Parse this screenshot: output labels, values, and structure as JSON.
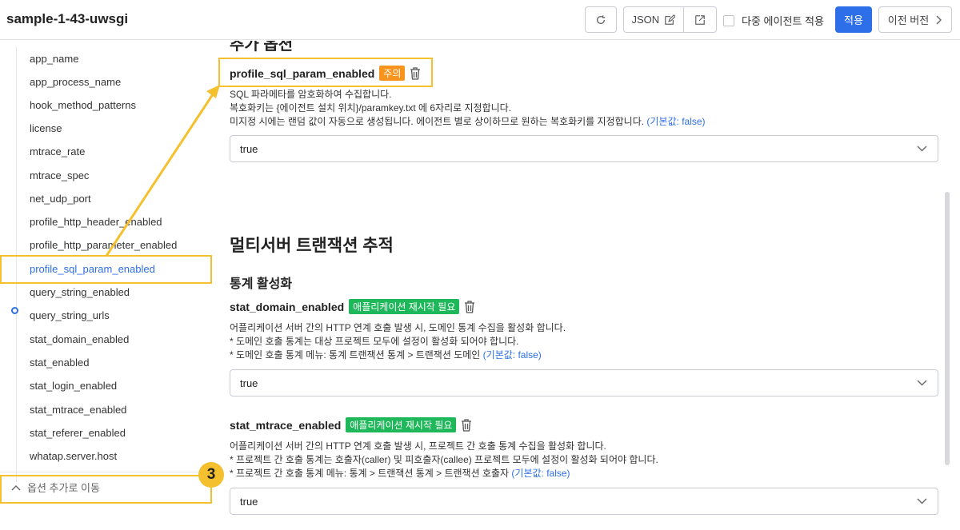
{
  "header": {
    "title": "sample-1-43-uwsgi",
    "json_label": "JSON",
    "multi_agent_label": "다중 에이전트 적용",
    "apply_label": "적용",
    "prev_version_label": "이전 버전"
  },
  "sidebar": {
    "items": [
      "app_name",
      "app_process_name",
      "hook_method_patterns",
      "license",
      "mtrace_rate",
      "mtrace_spec",
      "net_udp_port",
      "profile_http_header_enabled",
      "profile_http_parameter_enabled",
      "profile_sql_param_enabled",
      "query_string_enabled",
      "query_string_urls",
      "stat_domain_enabled",
      "stat_enabled",
      "stat_login_enabled",
      "stat_mtrace_enabled",
      "stat_referer_enabled",
      "whatap.server.host"
    ],
    "active_index": 9,
    "move_label": "옵션 추가로 이동",
    "step_badge": "3"
  },
  "main": {
    "cut_heading": "추가 옵션",
    "options": [
      {
        "name": "profile_sql_param_enabled",
        "tag": "주의",
        "lines": [
          "SQL 파라메타를 암호화하여 수집합니다.",
          "복호화키는 {에이전트 설치 위치}/paramkey.txt 에 6자리로 지정합니다.",
          "미지정 시에는 랜덤 값이 자동으로 생성됩니다. 에이전트 별로 상이하므로 원하는 복호화키를 지정합니다."
        ],
        "default": "(기본값: false)",
        "value": "true"
      },
      {
        "name": "stat_domain_enabled",
        "tag": "애플리케이션 재시작 필요",
        "lines": [
          "어플리케이션 서버 간의 HTTP 연계 호출 발생 시, 도메인 통계 수집을 활성화 합니다.",
          "* 도메인 호출 통계는 대상 프로젝트 모두에 설정이 활성화 되어야 합니다.",
          "* 도메인 호출 통계 메뉴: 통계 트랜잭션 통계 > 트랜잭션 도메인"
        ],
        "default": "(기본값: false)",
        "value": "true"
      },
      {
        "name": "stat_mtrace_enabled",
        "tag": "애플리케이션 재시작 필요",
        "lines": [
          "어플리케이션 서버 간의 HTTP 연계 호출 발생 시, 프로젝트 간 호출 통계 수집을 활성화 합니다.",
          "* 프로젝트 간 호출 통계는 호출자(caller) 및 피호출자(callee) 프로젝트 모두에 설정이 활성화 되어야 합니다.",
          "* 프로젝트 간 호출 통계 메뉴: 통계 > 트랜잭션 통계 > 트랜잭션 호출자"
        ],
        "default": "(기본값: false)",
        "value": "true"
      }
    ],
    "section_title": "멀티서버 트랜잭션 추적",
    "subsection_title": "통계 활성화"
  },
  "colors": {
    "accent": "#2d6fe8",
    "highlight": "#f5c02e",
    "warn_tag": "#f7941d",
    "restart_tag": "#1eb85a"
  }
}
